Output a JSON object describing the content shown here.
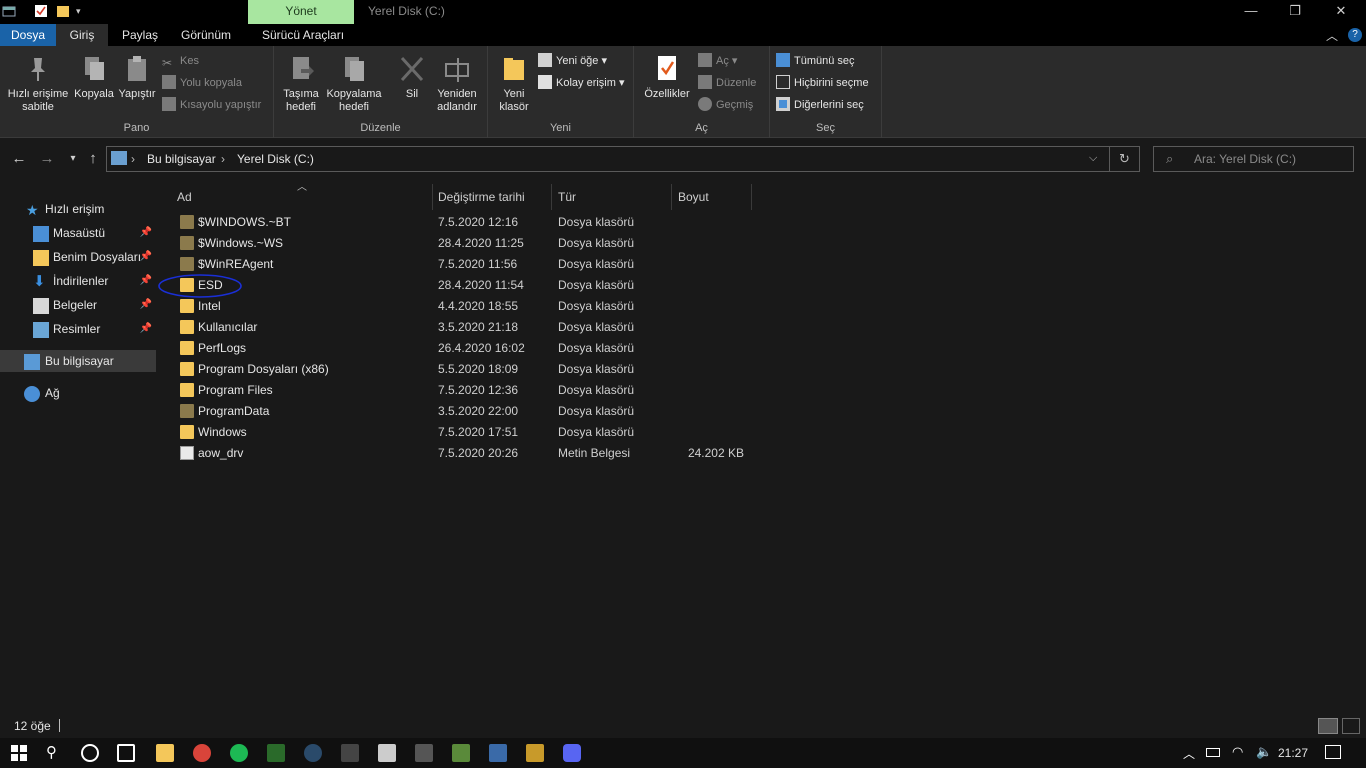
{
  "window": {
    "title": "Yerel Disk (C:)",
    "manage_tab": "Yönet",
    "minimize": "—",
    "maximize": "❐",
    "close": "✕"
  },
  "ribbon_tabs": [
    "Dosya",
    "Giriş",
    "Paylaş",
    "Görünüm",
    "Sürücü Araçları"
  ],
  "ribbon": {
    "clipboard": {
      "label": "Pano",
      "pin_quick": "Hızlı erişime sabitle",
      "copy": "Kopyala",
      "paste": "Yapıştır",
      "cut": "Kes",
      "copy_path": "Yolu kopyala",
      "paste_shortcut": "Kısayolu yapıştır"
    },
    "organize": {
      "label": "Düzenle",
      "move_to": "Taşıma hedefi",
      "copy_to": "Kopyalama hedefi",
      "delete": "Sil",
      "rename": "Yeniden adlandır"
    },
    "new": {
      "label": "Yeni",
      "new_folder": "Yeni klasör",
      "new_item": "Yeni öğe",
      "easy_access": "Kolay erişim"
    },
    "open": {
      "label": "Aç",
      "properties": "Özellikler",
      "open": "Aç",
      "edit": "Düzenle",
      "history": "Geçmiş"
    },
    "select": {
      "label": "Seç",
      "select_all": "Tümünü seç",
      "select_none": "Hiçbirini seçme",
      "invert": "Diğerlerini seç"
    }
  },
  "address": {
    "crumbs": [
      "Bu bilgisayar",
      "Yerel Disk (C:)"
    ],
    "search_placeholder": "Ara: Yerel Disk (C:)"
  },
  "nav": {
    "quick_access": "Hızlı erişim",
    "items": [
      {
        "label": "Masaüstü",
        "icon": "desktop-icon"
      },
      {
        "label": "Benim Dosyalarım",
        "icon": "folder-icon"
      },
      {
        "label": "İndirilenler",
        "icon": "download-icon"
      },
      {
        "label": "Belgeler",
        "icon": "documents-icon"
      },
      {
        "label": "Resimler",
        "icon": "pictures-icon"
      }
    ],
    "this_pc": "Bu bilgisayar",
    "network": "Ağ"
  },
  "columns": [
    "Ad",
    "Değiştirme tarihi",
    "Tür",
    "Boyut"
  ],
  "files": [
    {
      "name": "$WINDOWS.~BT",
      "date": "7.5.2020 12:16",
      "type": "Dosya klasörü",
      "size": "",
      "kind": "folder-hidden"
    },
    {
      "name": "$Windows.~WS",
      "date": "28.4.2020 11:25",
      "type": "Dosya klasörü",
      "size": "",
      "kind": "folder-hidden"
    },
    {
      "name": "$WinREAgent",
      "date": "7.5.2020 11:56",
      "type": "Dosya klasörü",
      "size": "",
      "kind": "folder-hidden"
    },
    {
      "name": "ESD",
      "date": "28.4.2020 11:54",
      "type": "Dosya klasörü",
      "size": "",
      "kind": "folder"
    },
    {
      "name": "Intel",
      "date": "4.4.2020 18:55",
      "type": "Dosya klasörü",
      "size": "",
      "kind": "folder"
    },
    {
      "name": "Kullanıcılar",
      "date": "3.5.2020 21:18",
      "type": "Dosya klasörü",
      "size": "",
      "kind": "folder"
    },
    {
      "name": "PerfLogs",
      "date": "26.4.2020 16:02",
      "type": "Dosya klasörü",
      "size": "",
      "kind": "folder"
    },
    {
      "name": "Program Dosyaları (x86)",
      "date": "5.5.2020 18:09",
      "type": "Dosya klasörü",
      "size": "",
      "kind": "folder"
    },
    {
      "name": "Program Files",
      "date": "7.5.2020 12:36",
      "type": "Dosya klasörü",
      "size": "",
      "kind": "folder"
    },
    {
      "name": "ProgramData",
      "date": "3.5.2020 22:00",
      "type": "Dosya klasörü",
      "size": "",
      "kind": "folder-hidden"
    },
    {
      "name": "Windows",
      "date": "7.5.2020 17:51",
      "type": "Dosya klasörü",
      "size": "",
      "kind": "folder"
    },
    {
      "name": "aow_drv",
      "date": "7.5.2020 20:26",
      "type": "Metin Belgesi",
      "size": "24.202 KB",
      "kind": "document"
    }
  ],
  "status": {
    "count": "12 öğe"
  },
  "taskbar": {
    "clock": "21:27"
  },
  "colors": {
    "accent": "#1a63a8",
    "manage_tab": "#a8e6a0",
    "folder": "#f4c75a",
    "annotation": "#1a2fd6"
  }
}
